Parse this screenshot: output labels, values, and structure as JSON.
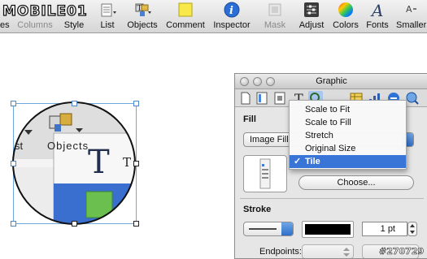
{
  "watermark_logo": "MOBILE01",
  "toolbar": {
    "items": [
      {
        "id": "shapes",
        "label": "es",
        "icon": "shapes-icon",
        "dim": false
      },
      {
        "id": "columns",
        "label": "Columns",
        "icon": "columns-icon",
        "dim": true
      },
      {
        "id": "style",
        "label": "Style",
        "icon": "style-icon",
        "dim": false
      },
      {
        "id": "list",
        "label": "List",
        "icon": "list-icon",
        "dim": false
      },
      {
        "id": "objects",
        "label": "Objects",
        "icon": "objects-icon",
        "dim": false
      },
      {
        "id": "comment",
        "label": "Comment",
        "icon": "comment-icon",
        "dim": false
      },
      {
        "id": "inspector",
        "label": "Inspector",
        "icon": "info-icon",
        "dim": false
      },
      {
        "id": "mask",
        "label": "Mask",
        "icon": "mask-icon",
        "dim": true
      },
      {
        "id": "adjust",
        "label": "Adjust",
        "icon": "adjust-icon",
        "dim": false
      },
      {
        "id": "colors",
        "label": "Colors",
        "icon": "color-wheel-icon",
        "dim": false
      },
      {
        "id": "fonts",
        "label": "Fonts",
        "icon": "fonts-icon",
        "dim": false
      },
      {
        "id": "smaller",
        "label": "Smaller",
        "icon": "smaller-icon",
        "dim": false
      }
    ]
  },
  "canvas": {
    "magnified_labels": {
      "list_fragment": "st",
      "objects": "Objects",
      "t_fragment": "T",
      "big_t": "T"
    }
  },
  "inspector": {
    "title": "Graphic",
    "fill": {
      "section_title": "Fill",
      "fill_type": "Image Fill",
      "choose_button": "Choose..."
    },
    "stroke": {
      "section_title": "Stroke",
      "width_value": "1 pt",
      "endpoints_label": "Endpoints:"
    },
    "colors": {
      "stroke_color": "#000000",
      "menu_highlight": "#3875d7"
    }
  },
  "image_mode_menu": {
    "items": [
      "Scale to Fit",
      "Scale to Fill",
      "Stretch",
      "Original Size",
      "Tile"
    ],
    "selected": "Tile",
    "check_mark": "✓"
  },
  "watermark_id": "#270729"
}
